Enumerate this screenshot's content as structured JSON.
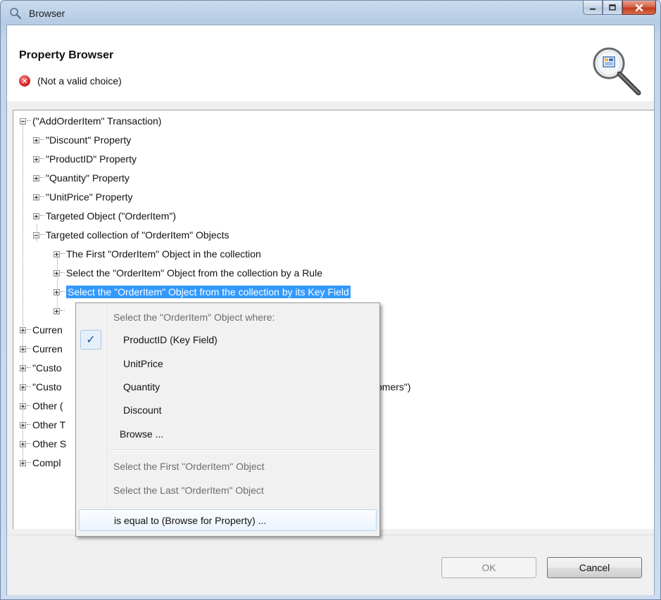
{
  "window": {
    "title": "Browser"
  },
  "header": {
    "title": "Property Browser",
    "error_text": "(Not a valid choice)"
  },
  "tree": {
    "items": [
      {
        "label": "(\"AddOrderItem\" Transaction)",
        "state": "expanded"
      },
      {
        "label": "\"Discount\" Property",
        "state": "collapsed"
      },
      {
        "label": "\"ProductID\" Property",
        "state": "collapsed"
      },
      {
        "label": "\"Quantity\" Property",
        "state": "collapsed"
      },
      {
        "label": "\"UnitPrice\" Property",
        "state": "collapsed"
      },
      {
        "label": "Targeted Object (\"OrderItem\")",
        "state": "collapsed"
      },
      {
        "label": "Targeted collection of \"OrderItem\" Objects",
        "state": "expanded"
      },
      {
        "label": "The First \"OrderItem\" Object in the collection",
        "state": "collapsed"
      },
      {
        "label": "Select the \"OrderItem\" Object from the collection by a Rule",
        "state": "collapsed"
      },
      {
        "label": "Select the \"OrderItem\" Object from the collection by its Key Field",
        "state": "collapsed",
        "selected": true
      },
      {
        "label": "",
        "state": "collapsed"
      },
      {
        "label": "Curren",
        "state": "collapsed"
      },
      {
        "label": "Curren",
        "state": "collapsed"
      },
      {
        "label": "\"Custo",
        "state": "collapsed"
      },
      {
        "label": "\"Custo",
        "state": "collapsed",
        "trailing": "omers\")"
      },
      {
        "label": "Other (",
        "state": "collapsed"
      },
      {
        "label": "Other T",
        "state": "collapsed"
      },
      {
        "label": "Other S",
        "state": "collapsed"
      },
      {
        "label": "Compl",
        "state": "collapsed"
      }
    ]
  },
  "context_menu": {
    "header": "Select the \"OrderItem\" Object where:",
    "items": [
      {
        "label": "ProductID (Key Field)",
        "checked": true
      },
      {
        "label": "UnitPrice"
      },
      {
        "label": "Quantity"
      },
      {
        "label": "Discount"
      },
      {
        "label": "Browse ..."
      }
    ],
    "disabled_items": [
      "Select the First \"OrderItem\" Object",
      "Select the Last \"OrderItem\" Object"
    ],
    "footer": "is equal to (Browse for Property) ..."
  },
  "buttons": {
    "ok": "OK",
    "cancel": "Cancel"
  },
  "colors": {
    "selection": "#3399ff",
    "error": "#d11d1d"
  }
}
